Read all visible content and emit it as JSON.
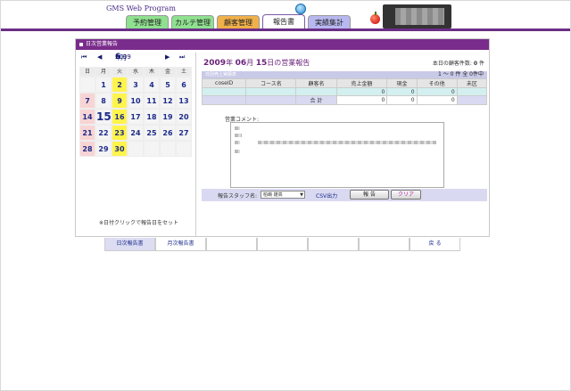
{
  "header": {
    "brand": "GMS Web Program",
    "tabs": [
      {
        "label": "予約管理",
        "color": "#8fe08f"
      },
      {
        "label": "カルテ管理",
        "color": "#8fe08f"
      },
      {
        "label": "顧客管理",
        "color": "#f0b04a"
      },
      {
        "label": "報告書",
        "color": "#ffffff",
        "active": true
      },
      {
        "label": "実績集計",
        "color": "#b8b8f0"
      }
    ]
  },
  "panel": {
    "title": "日次営業報告"
  },
  "calendar": {
    "prev_year": "⏮",
    "prev_month": "◀",
    "next_month": "▶",
    "next_year": "⏭",
    "year": "2009",
    "year_unit": "年",
    "month": "6",
    "month_unit": "月",
    "weekdays": [
      "日",
      "月",
      "火",
      "水",
      "木",
      "金",
      "土"
    ],
    "weeks": [
      [
        "",
        "1",
        "2",
        "3",
        "4",
        "5",
        "6"
      ],
      [
        "7",
        "8",
        "9",
        "10",
        "11",
        "12",
        "13"
      ],
      [
        "14",
        "15",
        "16",
        "17",
        "18",
        "19",
        "20"
      ],
      [
        "21",
        "22",
        "23",
        "24",
        "25",
        "26",
        "27"
      ],
      [
        "28",
        "29",
        "30",
        "",
        "",
        "",
        ""
      ]
    ],
    "note": "※日付クリックで報告日をセット"
  },
  "report": {
    "date_year": "2009",
    "date_year_unit": "年",
    "date_month": "06",
    "date_month_unit": "月",
    "date_day": "15",
    "date_day_unit": "日",
    "date_suffix": "の営業報告",
    "customer_count_label": "本日の顧客件数:",
    "customer_count": "0",
    "customer_count_unit": "件",
    "section_title": "日別売上実績表",
    "range_text": "1 ～ 0 件 全 0件中",
    "columns": [
      "coseID",
      "コース名",
      "顧客名",
      "売上金額",
      "現金",
      "その他",
      "未区"
    ],
    "row": [
      "",
      "",
      "",
      "0",
      "0",
      "0",
      ""
    ],
    "total_label": "合 計",
    "total": [
      "0",
      "0",
      "0"
    ],
    "comment_label": "営業コメント:",
    "staff_label": "報告スタッフ名:",
    "staff_value": "柏嶋 雄高",
    "csv_label": "CSV出力",
    "report_button": "報 告",
    "clear_button": "クリア"
  },
  "bottom_tabs": [
    {
      "label": "日次報告書",
      "active": true
    },
    {
      "label": "月次報告書"
    },
    {
      "label": ""
    },
    {
      "label": ""
    },
    {
      "label": ""
    },
    {
      "label": ""
    },
    {
      "label": "戻 る"
    }
  ]
}
